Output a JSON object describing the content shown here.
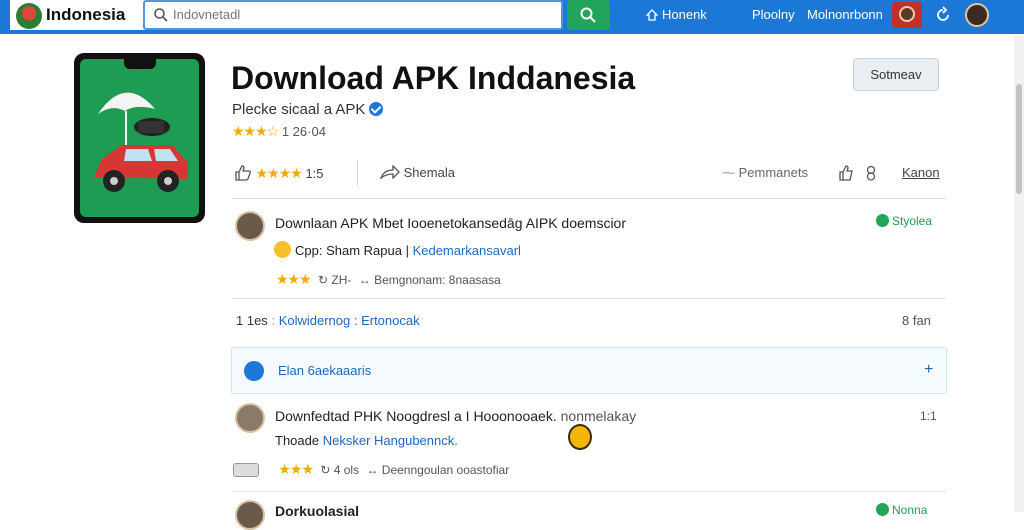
{
  "header": {
    "logo_text": "Indonesia",
    "search_placeholder": "Indovnetadl",
    "nav_home": "Honenk",
    "nav_links": [
      "Ploolny",
      "Molnonrbonn"
    ]
  },
  "app": {
    "title": "Download APK Inddanesia",
    "subtitle": "Plecke sicaal a APK",
    "rating_text": "1 26·04",
    "action_button": "Sotmeav"
  },
  "stats": {
    "rating_count": "1:5",
    "share_label": "Shemala",
    "permissions_label": "Pemmanets",
    "more_label": "Kanon"
  },
  "comments": [
    {
      "title": "Downlaan APK Mbet Iooenetokansedāg AIPK doemscior",
      "line_prefix": "Cpp: Sham Rapua",
      "line_link": "Kedemarkansavarl",
      "meta_count": "ZH-",
      "meta_text": "Bemgnonam: 8naasasa",
      "badge": "Styolea"
    },
    {
      "title": "Downfedtad PHK Noogdresl a I Hooonooaek.",
      "title_suffix": "nonmelakay",
      "line_prefix": "Thoade",
      "line_link": "Neksker Hangubennck.",
      "meta_count": "4 ols",
      "meta_text": "Deenngoulan ooastofiar",
      "right": "1:1"
    },
    {
      "title": "Dorkuolasial",
      "badge": "Nonna"
    }
  ],
  "info_row": {
    "left": "1 1es",
    "link": "Kolwidernog : Ertonocak",
    "right": "8 fan"
  },
  "notice": {
    "text": "Elan 6aekaaaris"
  },
  "colors": {
    "brand_blue": "#1b78d6",
    "accent_green": "#22a55a",
    "star": "#f2a900"
  }
}
